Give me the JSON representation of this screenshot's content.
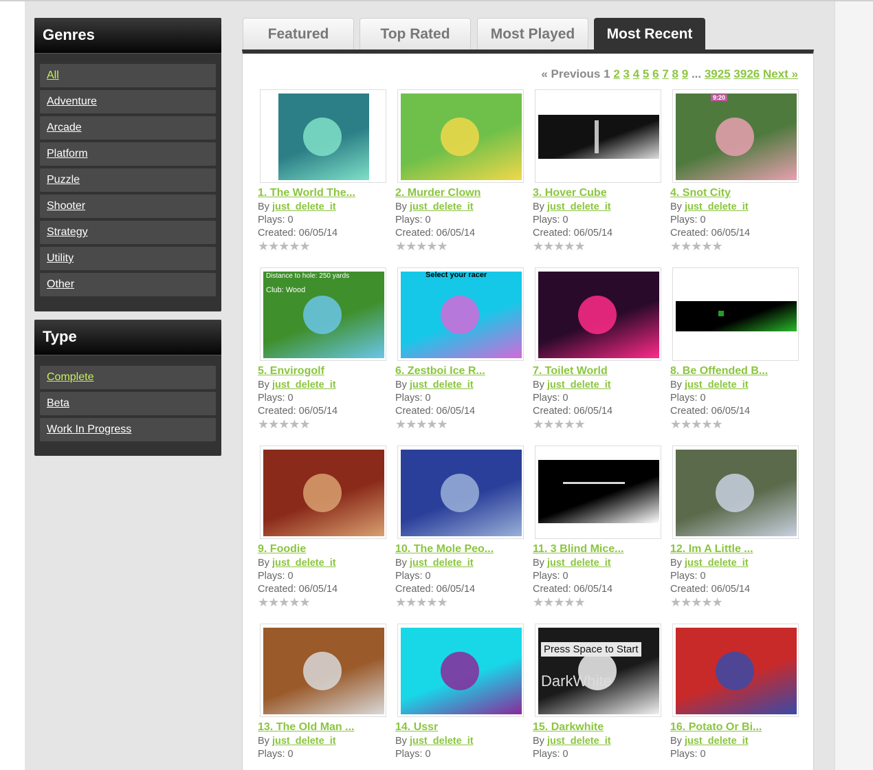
{
  "genres": {
    "title": "Genres",
    "items": [
      "All",
      "Adventure",
      "Arcade",
      "Platform",
      "Puzzle",
      "Shooter",
      "Strategy",
      "Utility",
      "Other"
    ]
  },
  "types": {
    "title": "Type",
    "items": [
      "Complete",
      "Beta",
      "Work In Progress"
    ]
  },
  "tabs": [
    "Featured",
    "Top Rated",
    "Most Played",
    "Most Recent"
  ],
  "pager": {
    "previous": "« Previous",
    "current": "1",
    "pages": [
      "2",
      "3",
      "4",
      "5",
      "6",
      "7",
      "8",
      "9"
    ],
    "ellipsis": "...",
    "last_pages": [
      "3925",
      "3926"
    ],
    "next": "Next »"
  },
  "labels": {
    "by": "By",
    "plays": "Plays:",
    "created": "Created:"
  },
  "games": [
    {
      "title": "1.  The World The...",
      "author": "just_delete_it",
      "plays": "0",
      "created": "06/05/14",
      "thumb": {
        "bg": "#2c7f86",
        "accent": "#7fe0c8"
      }
    },
    {
      "title": "2.  Murder Clown",
      "author": "just_delete_it",
      "plays": "0",
      "created": "06/05/14",
      "thumb": {
        "bg": "#6fc04a",
        "accent": "#f0d84a"
      }
    },
    {
      "title": "3.  Hover Cube",
      "author": "just_delete_it",
      "plays": "0",
      "created": "06/05/14",
      "thumb": {
        "bg": "#111111",
        "accent": "#dddddd"
      }
    },
    {
      "title": "4.  Snot City",
      "author": "just_delete_it",
      "plays": "0",
      "created": "06/05/14",
      "thumb": {
        "bg": "#4e7a3e",
        "accent": "#e8a0b0"
      }
    },
    {
      "title": "5.  Envirogolf",
      "author": "just_delete_it",
      "plays": "0",
      "created": "06/05/14",
      "thumb": {
        "bg": "#3f8f2c",
        "accent": "#6ac6e8"
      }
    },
    {
      "title": "6.  Zestboi Ice R...",
      "author": "just_delete_it",
      "plays": "0",
      "created": "06/05/14",
      "thumb": {
        "bg": "#16c8e8",
        "accent": "#d26ad8"
      }
    },
    {
      "title": "7.  Toilet World",
      "author": "just_delete_it",
      "plays": "0",
      "created": "06/05/14",
      "thumb": {
        "bg": "#2a0a2a",
        "accent": "#ff2b8a"
      }
    },
    {
      "title": "8.  Be Offended B...",
      "author": "just_delete_it",
      "plays": "0",
      "created": "06/05/14",
      "thumb": {
        "bg": "#000000",
        "accent": "#2ab82a"
      }
    },
    {
      "title": "9.  Foodie",
      "author": "just_delete_it",
      "plays": "0",
      "created": "06/05/14",
      "thumb": {
        "bg": "#8a2a1a",
        "accent": "#d8a070"
      }
    },
    {
      "title": "10.  The Mole Peo...",
      "author": "just_delete_it",
      "plays": "0",
      "created": "06/05/14",
      "thumb": {
        "bg": "#2a3f9a",
        "accent": "#9ab0d8"
      }
    },
    {
      "title": "11.  3 Blind Mice...",
      "author": "just_delete_it",
      "plays": "0",
      "created": "06/05/14",
      "thumb": {
        "bg": "#000000",
        "accent": "#ffffff"
      }
    },
    {
      "title": "12.  Im A Little ...",
      "author": "just_delete_it",
      "plays": "0",
      "created": "06/05/14",
      "thumb": {
        "bg": "#5a6a4a",
        "accent": "#c8d0e0"
      }
    },
    {
      "title": "13.  The Old Man ...",
      "author": "just_delete_it",
      "plays": "0",
      "created": "",
      "thumb": {
        "bg": "#9a5a2a",
        "accent": "#d8d8d8"
      }
    },
    {
      "title": "14.  Ussr",
      "author": "just_delete_it",
      "plays": "0",
      "created": "",
      "thumb": {
        "bg": "#18d8e8",
        "accent": "#8a2a9a"
      }
    },
    {
      "title": "15.  Darkwhite",
      "author": "just_delete_it",
      "plays": "0",
      "created": "",
      "thumb": {
        "bg": "#1a1a1a",
        "accent": "#f0f0f0"
      }
    },
    {
      "title": "16.  Potato Or Bi...",
      "author": "just_delete_it",
      "plays": "0",
      "created": "",
      "thumb": {
        "bg": "#c82a2a",
        "accent": "#3a4aa8"
      }
    }
  ],
  "thumb_texts": {
    "golf_line1": "Distance to hole: 250 yards",
    "golf_line2": "Club: Wood",
    "racer": "Select your racer",
    "snot_time": "9:20",
    "press_space": "Press Space to Start",
    "darkwhite": "DarkWhite"
  },
  "rating_stars": "★★★★★"
}
